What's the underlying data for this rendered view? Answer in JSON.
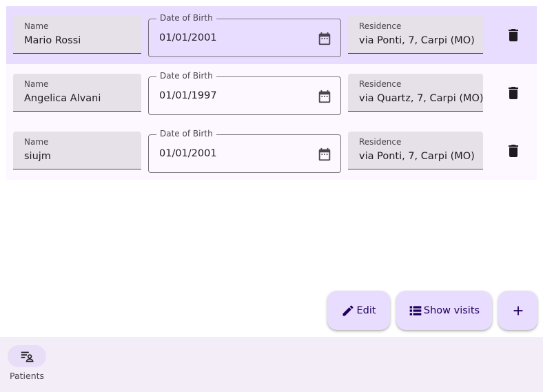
{
  "patients": [
    {
      "name_label": "Name",
      "name": "Mario Rossi",
      "dob_label": "Date of Birth",
      "dob": "01/01/2001",
      "residence_label": "Residence",
      "residence": "via Ponti, 7, Carpi (MO)",
      "selected": true
    },
    {
      "name_label": "Name",
      "name": "Angelica Alvani",
      "dob_label": "Date of Birth",
      "dob": "01/01/1997",
      "residence_label": "Residence",
      "residence": "via Quartz, 7, Carpi (MO)",
      "selected": false
    },
    {
      "name_label": "Name",
      "name": "siujm",
      "dob_label": "Date of Birth",
      "dob": "01/01/2001",
      "residence_label": "Residence",
      "residence": "via Ponti, 7, Carpi (MO)",
      "selected": false
    }
  ],
  "actions": {
    "edit_label": "Edit",
    "show_visits_label": "Show visits"
  },
  "nav": {
    "patients_label": "Patients"
  },
  "icons": {
    "calendar": "calendar-icon",
    "delete": "trash-icon",
    "edit": "pencil-icon",
    "list": "list-icon",
    "add": "plus-icon",
    "patients": "person-list-icon"
  },
  "colors": {
    "selected_row": "#e9ddff",
    "row": "#fdf7ff",
    "field_fill": "#e6e0e9",
    "fab": "#e9ddff",
    "navbar": "#f3edf7",
    "nav_pill": "#e8def8"
  }
}
